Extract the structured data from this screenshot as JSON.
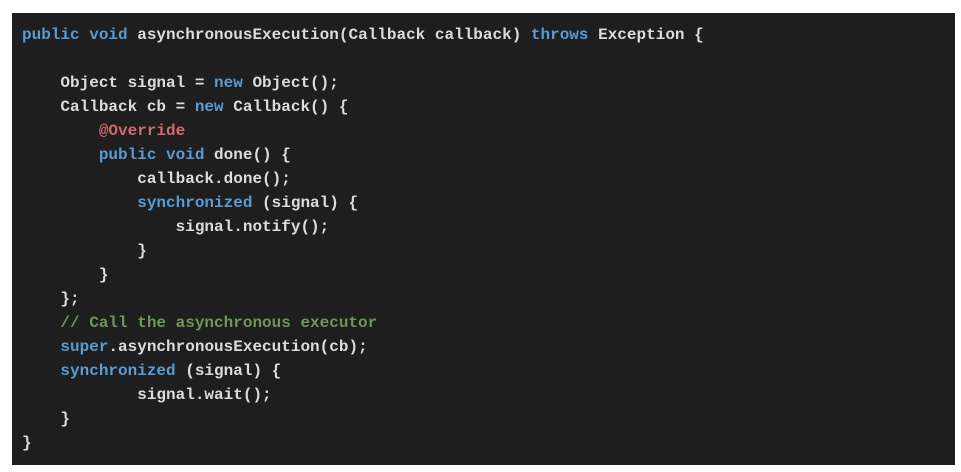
{
  "colors": {
    "background": "#1e1e1e",
    "text": "#dcdcdc",
    "keyword": "#569cd6",
    "annotation": "#d16969",
    "comment": "#6a9955"
  },
  "code": {
    "language": "java",
    "lines": [
      [
        [
          "kw",
          "public"
        ],
        [
          "tx",
          " "
        ],
        [
          "kw",
          "void"
        ],
        [
          "tx",
          " asynchronousExecution(Callback callback) "
        ],
        [
          "kw",
          "throws"
        ],
        [
          "tx",
          " Exception {"
        ]
      ],
      [],
      [
        [
          "tx",
          "    Object signal = "
        ],
        [
          "kw",
          "new"
        ],
        [
          "tx",
          " Object();"
        ]
      ],
      [
        [
          "tx",
          "    Callback cb = "
        ],
        [
          "kw",
          "new"
        ],
        [
          "tx",
          " Callback() {"
        ]
      ],
      [
        [
          "tx",
          "        "
        ],
        [
          "ann",
          "@Override"
        ]
      ],
      [
        [
          "tx",
          "        "
        ],
        [
          "kw",
          "public"
        ],
        [
          "tx",
          " "
        ],
        [
          "kw",
          "void"
        ],
        [
          "tx",
          " done() {"
        ]
      ],
      [
        [
          "tx",
          "            callback.done();"
        ]
      ],
      [
        [
          "tx",
          "            "
        ],
        [
          "kw",
          "synchronized"
        ],
        [
          "tx",
          " (signal) {"
        ]
      ],
      [
        [
          "tx",
          "                signal.notify();"
        ]
      ],
      [
        [
          "tx",
          "            }"
        ]
      ],
      [
        [
          "tx",
          "        }"
        ]
      ],
      [
        [
          "tx",
          "    };"
        ]
      ],
      [
        [
          "tx",
          "    "
        ],
        [
          "cm",
          "// Call the asynchronous executor"
        ]
      ],
      [
        [
          "tx",
          "    "
        ],
        [
          "kw",
          "super"
        ],
        [
          "tx",
          ".asynchronousExecution(cb);"
        ]
      ],
      [
        [
          "tx",
          "    "
        ],
        [
          "kw",
          "synchronized"
        ],
        [
          "tx",
          " (signal) {"
        ]
      ],
      [
        [
          "tx",
          "            signal.wait();"
        ]
      ],
      [
        [
          "tx",
          "    }"
        ]
      ],
      [
        [
          "tx",
          "}"
        ]
      ]
    ]
  }
}
